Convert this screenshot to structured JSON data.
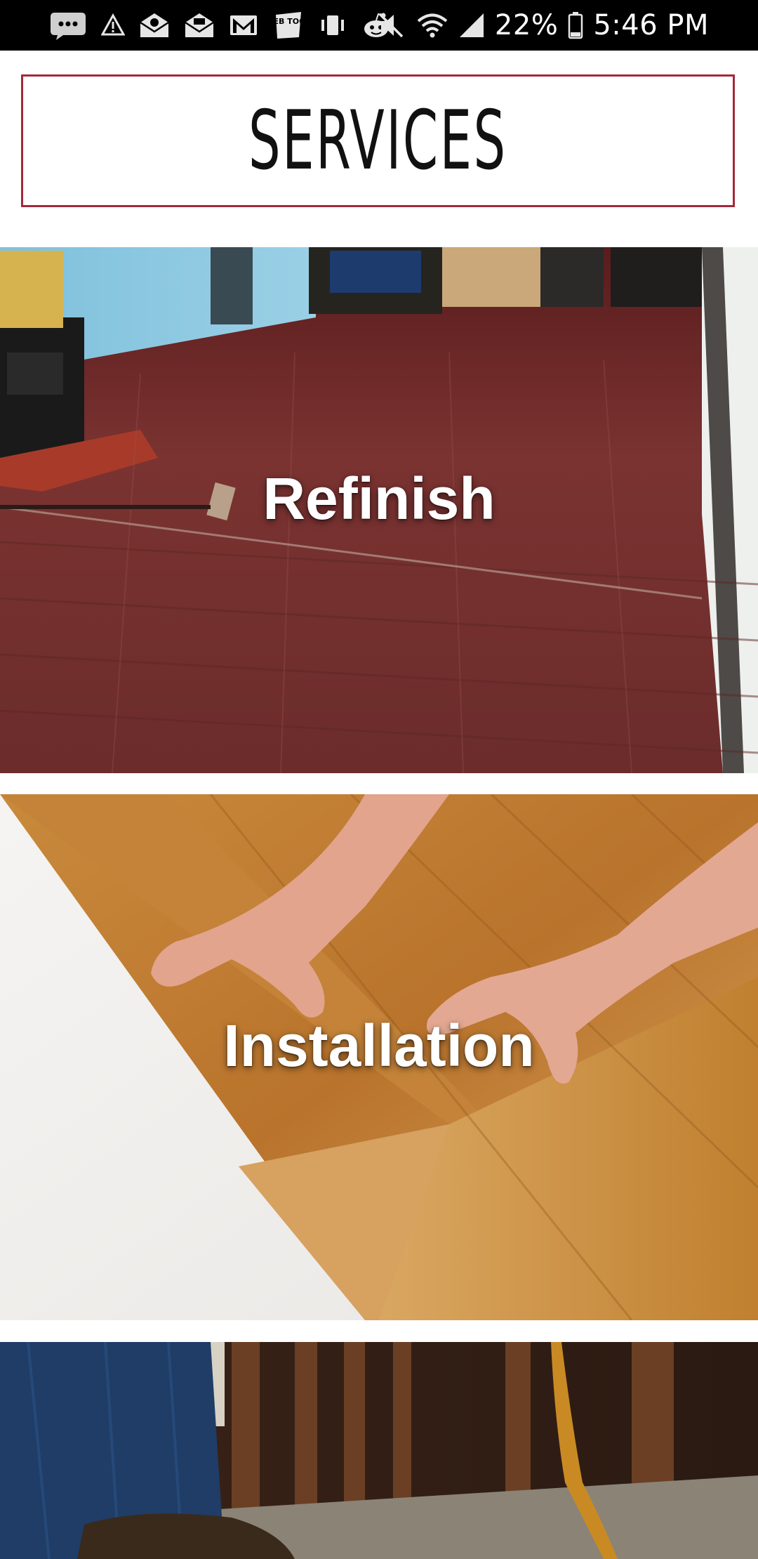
{
  "status_bar": {
    "battery": "22%",
    "time": "5:46 PM",
    "left_icons": [
      "messages-icon",
      "warning-icon",
      "email-icon",
      "email-icon",
      "gmail-icon",
      "webtoon-icon",
      "vibrate-icon",
      "reddit-icon"
    ],
    "right_icons": [
      "mute-icon",
      "wifi-icon",
      "signal-icon",
      "battery-icon"
    ],
    "webtoon_text": "WEB TOON"
  },
  "header": {
    "title": "SERVICES",
    "border_color": "#a3293a"
  },
  "services": [
    {
      "label": "Refinish"
    },
    {
      "label": "Installation"
    },
    {
      "label": ""
    }
  ]
}
